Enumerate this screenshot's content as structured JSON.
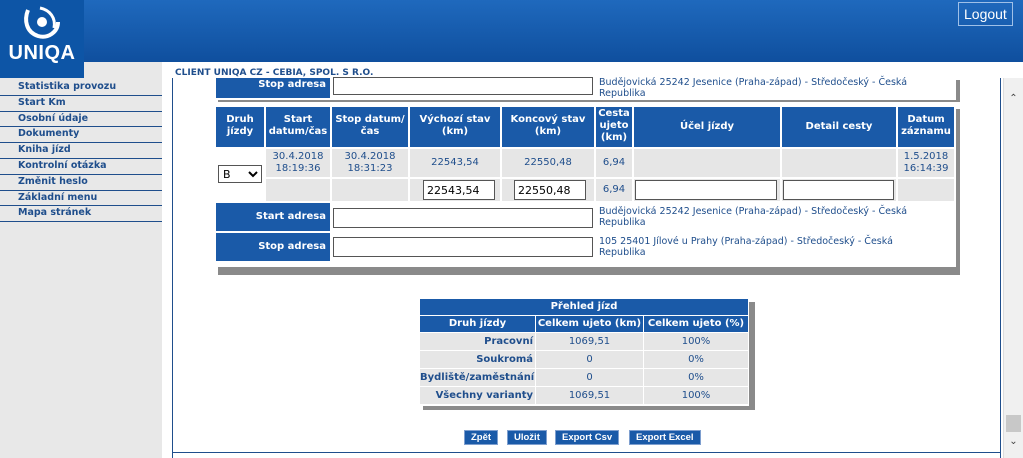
{
  "app": {
    "logo_text": "UNIQA",
    "logout_label": "Logout",
    "client_name": "CLIENT UNIQA CZ - CEBIA, SPOL. S R.O."
  },
  "sidebar": {
    "items": [
      {
        "label": "Statistika provozu"
      },
      {
        "label": "Start Km"
      },
      {
        "label": "Osobní údaje"
      },
      {
        "label": "Dokumenty"
      },
      {
        "label": "Kniha jízd"
      },
      {
        "label": "Kontrolní otázka"
      },
      {
        "label": "Změnit heslo"
      },
      {
        "label": "Základní menu"
      },
      {
        "label": "Mapa stránek"
      }
    ]
  },
  "top_fragment": {
    "stop_label": "Stop adresa",
    "address_line1": "Budějovická 25242 Jesenice (Praha-západ) - Středočeský - Česká",
    "address_line2": "Republika"
  },
  "trip_table": {
    "headers": {
      "druh": "Druh jízdy",
      "start": "Start datum/čas",
      "stop": "Stop datum/čas",
      "vychozi": "Výchozí stav (km)",
      "koncovy": "Koncový stav (km)",
      "cesta": "Cesta ujeto (km)",
      "ucel": "Účel jízdy",
      "detail": "Detail cesty",
      "datum": "Datum záznamu"
    },
    "row": {
      "druh_selected": "B",
      "start_date": "30.4.2018",
      "start_time": "18:19:36",
      "stop_date": "30.4.2018",
      "stop_time": "18:31:23",
      "vychozi": "22543,54",
      "koncovy": "22550,48",
      "cesta": "6,94",
      "datum_date": "1.5.2018",
      "datum_time": "16:14:39"
    },
    "edit": {
      "vychozi": "22543,54",
      "koncovy": "22550,48",
      "cesta": "6,94",
      "ucel": "",
      "detail": ""
    },
    "start_label": "Start adresa",
    "start_address_line1": "Budějovická 25242 Jesenice (Praha-západ) - Středočeský - Česká",
    "start_address_line2": "Republika",
    "stop_label": "Stop adresa",
    "stop_address_line1": "105 25401 Jílové u Prahy (Praha-západ) - Středočeský - Česká",
    "stop_address_line2": "Republika"
  },
  "summary": {
    "title": "Přehled jízd",
    "headers": [
      "Druh jízdy",
      "Celkem ujeto (km)",
      "Celkem ujeto (%)"
    ],
    "rows": [
      {
        "druh": "Pracovní",
        "km": "1069,51",
        "pct": "100%"
      },
      {
        "druh": "Soukromá",
        "km": "0",
        "pct": "0%"
      },
      {
        "druh": "Bydliště/zaměstnání",
        "km": "0",
        "pct": "0%"
      },
      {
        "druh": "Všechny varianty",
        "km": "1069,51",
        "pct": "100%"
      }
    ]
  },
  "buttons": {
    "back": "Zpět",
    "save": "Uložit",
    "export_csv": "Export Csv",
    "export_excel": "Export Excel"
  },
  "colors": {
    "brand": "#1a5aa8",
    "banner": "#1f69bd",
    "text": "#1f4e8c",
    "cell_bg": "#e6e6e6"
  }
}
